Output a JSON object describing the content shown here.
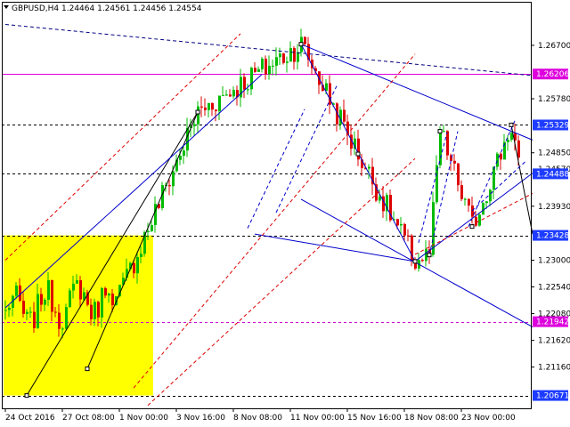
{
  "chart_data": {
    "type": "candlestick",
    "title": "GBPUSD,H4  1.24464 1.24561 1.24456 1.24554",
    "symbol": "GBPUSD",
    "timeframe": "H4",
    "ohlc_header": [
      "1.24464",
      "1.24561",
      "1.24456",
      "1.24554"
    ],
    "ylim": [
      1.2045,
      1.2745
    ],
    "y_ticks": [
      "1.26700",
      "1.25780",
      "1.24850",
      "1.23930",
      "1.23000",
      "1.22540",
      "1.22080",
      "1.21620",
      "1.21160"
    ],
    "y_tick_values": [
      1.267,
      1.2578,
      1.2485,
      1.2393,
      1.23,
      1.2254,
      1.2208,
      1.2162,
      1.2116
    ],
    "x_ticks": [
      "24 Oct 2016",
      "27 Oct 08:00",
      "1 Nov 00:00",
      "3 Nov 16:00",
      "8 Nov 08:00",
      "11 Nov 00:00",
      "15 Nov 16:00",
      "18 Nov 08:00",
      "23 Nov 00:00"
    ],
    "x_tick_bars": [
      0,
      16,
      32,
      48,
      64,
      80,
      96,
      112,
      128
    ],
    "bar_count": 145,
    "price_levels": [
      {
        "value": 1.26206,
        "label": "1.26206",
        "style": "solid",
        "color": "#dd00dd",
        "label_bg": "#dd00dd"
      },
      {
        "value": 1.25329,
        "label": "1.25329",
        "style": "dashed",
        "color": "#000000",
        "label_bg": "#1e3cff"
      },
      {
        "value": 1.24488,
        "label": "1.24488",
        "style": "dashed",
        "color": "#000000",
        "label_bg": "#1e3cff"
      },
      {
        "value": 1.23428,
        "label": "1.23428",
        "style": "dashed",
        "color": "#000000",
        "label_bg": "#1e3cff"
      },
      {
        "value": 1.21942,
        "label": "1.21942",
        "style": "dashed",
        "color": "#cc00cc",
        "label_bg": "#dd00dd"
      },
      {
        "value": 1.20671,
        "label": "1.20671",
        "style": "dashed",
        "color": "#000000",
        "label_bg": "#1e3cff"
      }
    ],
    "hidden_tick": "1.24570",
    "rectangle": {
      "bar_start": 0,
      "bar_end": 42,
      "price_high": 1.23428,
      "price_low": 1.20671,
      "color": "#ffff00"
    },
    "anchors": [
      {
        "bar": 6,
        "price": 1.2067
      },
      {
        "bar": 23,
        "price": 1.2113
      },
      {
        "bar": 54,
        "price": 1.2555
      },
      {
        "bar": 83,
        "price": 1.2672
      },
      {
        "bar": 99,
        "price": 1.2483
      },
      {
        "bar": 115,
        "price": 1.2298
      },
      {
        "bar": 119,
        "price": 1.2309
      },
      {
        "bar": 122,
        "price": 1.2522
      },
      {
        "bar": 131,
        "price": 1.2358
      },
      {
        "bar": 142,
        "price": 1.2533
      },
      {
        "bar": 148,
        "price": 1.2345
      }
    ],
    "segments": [
      {
        "from": [
          6,
          1.2067
        ],
        "to": [
          54,
          1.2555
        ],
        "color": "#000000",
        "style": "solid"
      },
      {
        "from": [
          23,
          1.2113
        ],
        "to": [
          54,
          1.2555
        ],
        "color": "#000000",
        "style": "solid"
      },
      {
        "from": [
          0,
          1.2218
        ],
        "to": [
          72,
          1.262
        ],
        "color": "#0000cc",
        "style": "solid"
      },
      {
        "from": [
          70,
          1.2345
        ],
        "to": [
          115,
          1.2298
        ],
        "color": "#0000cc",
        "style": "solid"
      },
      {
        "from": [
          83,
          1.2672
        ],
        "to": [
          115,
          1.2298
        ],
        "color": "#0000cc",
        "style": "solid"
      },
      {
        "from": [
          83,
          1.2672
        ],
        "to": [
          148,
          1.2507
        ],
        "color": "#0000cc",
        "style": "solid"
      },
      {
        "from": [
          83,
          1.2405
        ],
        "to": [
          148,
          1.2185
        ],
        "color": "#0000cc",
        "style": "solid"
      },
      {
        "from": [
          115,
          1.2298
        ],
        "to": [
          148,
          1.245
        ],
        "color": "#0000cc",
        "style": "solid"
      },
      {
        "from": [
          142,
          1.2533
        ],
        "to": [
          148,
          1.2345
        ],
        "color": "#000000",
        "style": "solid"
      },
      {
        "from": [
          0,
          1.2706
        ],
        "to": [
          148,
          1.2618
        ],
        "color": "#000080",
        "style": "dashed"
      },
      {
        "from": [
          36,
          1.208
        ],
        "to": [
          115,
          1.2655
        ],
        "color": "#dd0000",
        "style": "dashed"
      },
      {
        "from": [
          0,
          1.23
        ],
        "to": [
          66,
          1.269
        ],
        "color": "#dd0000",
        "style": "dashed"
      },
      {
        "from": [
          40,
          1.205
        ],
        "to": [
          115,
          1.2475
        ],
        "color": "#dd0000",
        "style": "dashed"
      },
      {
        "from": [
          115,
          1.231
        ],
        "to": [
          148,
          1.2415
        ],
        "color": "#dd0000",
        "style": "dashed"
      },
      {
        "from": [
          76,
          1.2382
        ],
        "to": [
          93,
          1.26
        ],
        "color": "#0000cc",
        "style": "dashed"
      },
      {
        "from": [
          68,
          1.2355
        ],
        "to": [
          84,
          1.256
        ],
        "color": "#0000cc",
        "style": "dashed"
      },
      {
        "from": [
          119,
          1.2309
        ],
        "to": [
          127,
          1.2522
        ],
        "color": "#0000cc",
        "style": "dashed"
      },
      {
        "from": [
          116,
          1.233
        ],
        "to": [
          124,
          1.252
        ],
        "color": "#0000cc",
        "style": "dashed"
      },
      {
        "from": [
          130,
          1.2358
        ],
        "to": [
          143,
          1.254
        ],
        "color": "#0000cc",
        "style": "dashed"
      },
      {
        "from": [
          131,
          1.2385
        ],
        "to": [
          146,
          1.247
        ],
        "color": "#0000cc",
        "style": "dashed"
      }
    ],
    "colors": {
      "bull": "#00bb00",
      "bear": "#dd0000",
      "background": "#ffffff"
    }
  }
}
